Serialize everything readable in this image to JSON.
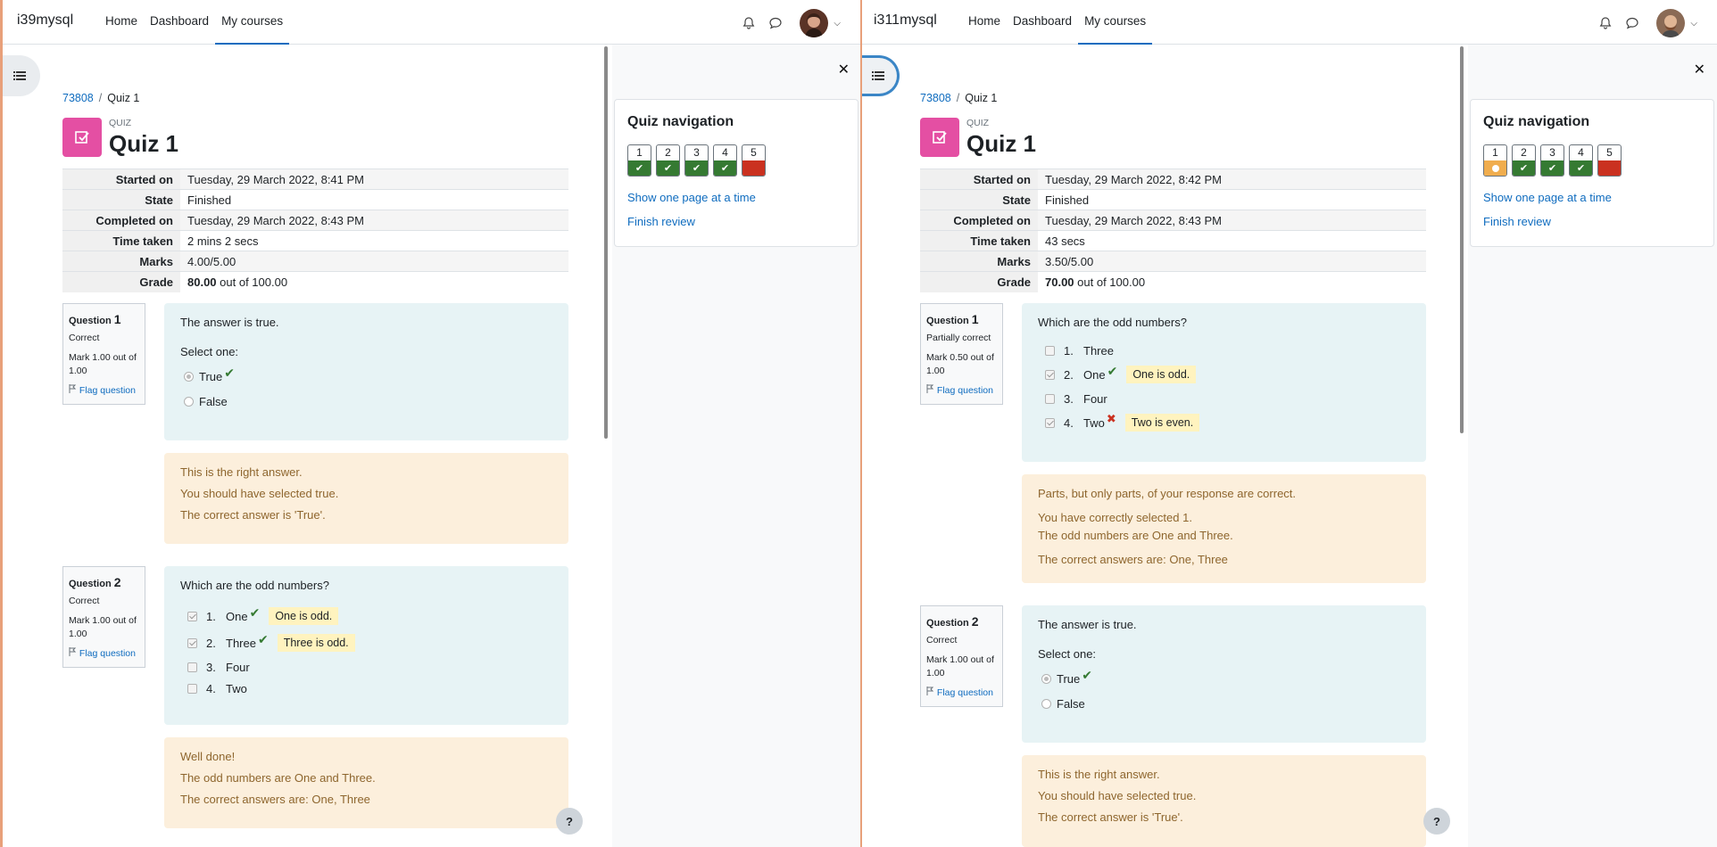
{
  "left": {
    "site_name": "i39mysql",
    "nav": [
      "Home",
      "Dashboard",
      "My courses"
    ],
    "breadcrumb": [
      "73808",
      "Quiz 1"
    ],
    "quiz_label": "QUIZ",
    "quiz_title": "Quiz 1",
    "summary": [
      {
        "label": "Started on",
        "value": "Tuesday, 29 March 2022, 8:41 PM"
      },
      {
        "label": "State",
        "value": "Finished"
      },
      {
        "label": "Completed on",
        "value": "Tuesday, 29 March 2022, 8:43 PM"
      },
      {
        "label": "Time taken",
        "value": "2 mins 2 secs"
      },
      {
        "label": "Marks",
        "value": "4.00/5.00"
      },
      {
        "label": "Grade",
        "value_bold": "80.00",
        "value_rest": " out of 100.00"
      }
    ],
    "q1": {
      "question_word": "Question",
      "number": "1",
      "state": "Correct",
      "mark": "Mark 1.00 out of 1.00",
      "flag": "Flag question",
      "text": "The answer is true.",
      "prompt": "Select one:",
      "options": [
        "True",
        "False"
      ],
      "feedback": [
        "This is the right answer.",
        "You should have selected true.",
        "The correct answer is 'True'."
      ]
    },
    "q2": {
      "question_word": "Question",
      "number": "2",
      "state": "Correct",
      "mark": "Mark 1.00 out of 1.00",
      "flag": "Flag question",
      "text": "Which are the odd numbers?",
      "options": [
        {
          "num": "1.",
          "label": "One",
          "fb": "One is odd."
        },
        {
          "num": "2.",
          "label": "Three",
          "fb": "Three is odd."
        },
        {
          "num": "3.",
          "label": "Four",
          "fb": ""
        },
        {
          "num": "4.",
          "label": "Two",
          "fb": ""
        }
      ],
      "feedback": [
        "Well done!",
        "The odd numbers are One and Three.",
        "The correct answers are: One, Three"
      ]
    },
    "quiz_nav": {
      "title": "Quiz navigation",
      "buttons": [
        {
          "n": "1",
          "state": "correct"
        },
        {
          "n": "2",
          "state": "correct"
        },
        {
          "n": "3",
          "state": "correct"
        },
        {
          "n": "4",
          "state": "correct"
        },
        {
          "n": "5",
          "state": "incorrect"
        }
      ],
      "show_one_page": "Show one page at a time",
      "finish_review": "Finish review"
    },
    "help": "?"
  },
  "right": {
    "site_name": "i311mysql",
    "nav": [
      "Home",
      "Dashboard",
      "My courses"
    ],
    "breadcrumb": [
      "73808",
      "Quiz 1"
    ],
    "quiz_label": "QUIZ",
    "quiz_title": "Quiz 1",
    "summary": [
      {
        "label": "Started on",
        "value": "Tuesday, 29 March 2022, 8:42 PM"
      },
      {
        "label": "State",
        "value": "Finished"
      },
      {
        "label": "Completed on",
        "value": "Tuesday, 29 March 2022, 8:43 PM"
      },
      {
        "label": "Time taken",
        "value": "43 secs"
      },
      {
        "label": "Marks",
        "value": "3.50/5.00"
      },
      {
        "label": "Grade",
        "value_bold": "70.00",
        "value_rest": " out of 100.00"
      }
    ],
    "q1": {
      "question_word": "Question",
      "number": "1",
      "state": "Partially correct",
      "mark": "Mark 0.50 out of 1.00",
      "flag": "Flag question",
      "text": "Which are the odd numbers?",
      "options": [
        {
          "num": "1.",
          "label": "Three",
          "fb": ""
        },
        {
          "num": "2.",
          "label": "One",
          "fb": "One is odd."
        },
        {
          "num": "3.",
          "label": "Four",
          "fb": ""
        },
        {
          "num": "4.",
          "label": "Two",
          "fb": "Two is even."
        }
      ],
      "feedback": [
        "Parts, but only parts, of your response are correct.",
        "You have correctly selected 1.",
        "The odd numbers are One and Three.",
        "The correct answers are: One, Three"
      ]
    },
    "q2": {
      "question_word": "Question",
      "number": "2",
      "state": "Correct",
      "mark": "Mark 1.00 out of 1.00",
      "flag": "Flag question",
      "text": "The answer is true.",
      "prompt": "Select one:",
      "options": [
        "True",
        "False"
      ],
      "feedback": [
        "This is the right answer.",
        "You should have selected true.",
        "The correct answer is 'True'."
      ]
    },
    "quiz_nav": {
      "title": "Quiz navigation",
      "buttons": [
        {
          "n": "1",
          "state": "partial"
        },
        {
          "n": "2",
          "state": "correct"
        },
        {
          "n": "3",
          "state": "correct"
        },
        {
          "n": "4",
          "state": "correct"
        },
        {
          "n": "5",
          "state": "incorrect"
        }
      ],
      "show_one_page": "Show one page at a time",
      "finish_review": "Finish review"
    },
    "help": "?"
  },
  "icons": {
    "tick": "✔",
    "cross": "✖",
    "close": "✕"
  },
  "colors": {
    "link": "#0f6cbf",
    "correct": "#357a32",
    "incorrect": "#ca3120",
    "partial": "#f0ad4e",
    "quiz_icon": "#e44fa3",
    "question_bg": "#e7f3f5",
    "feedback_bg": "#fcefdc"
  }
}
